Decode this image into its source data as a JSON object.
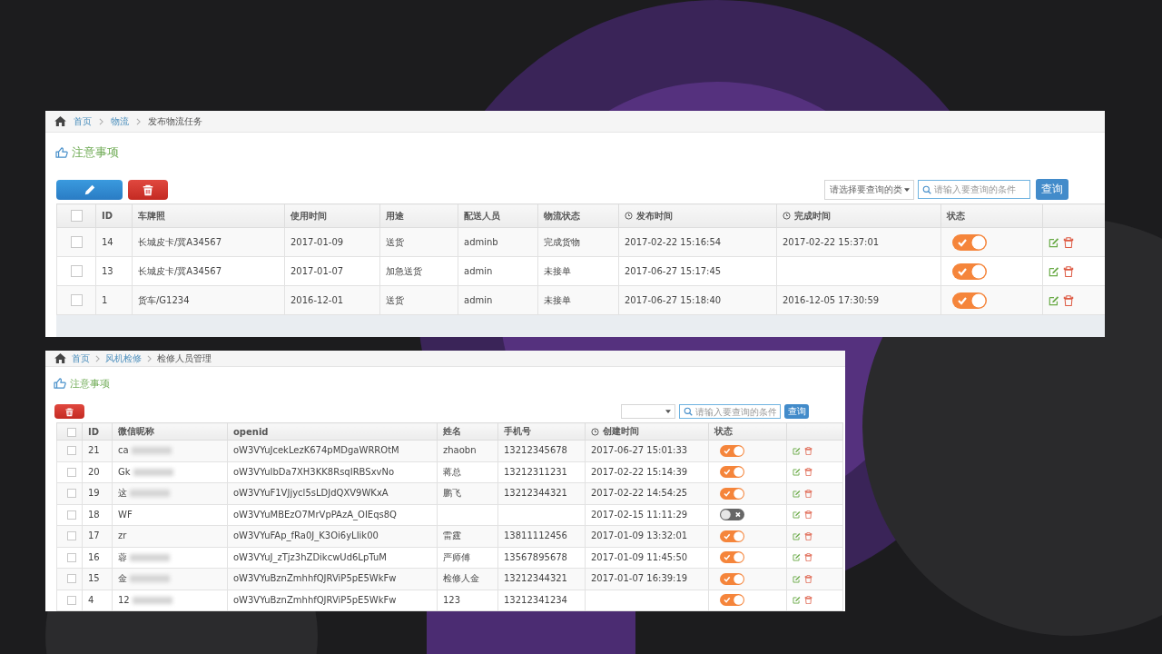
{
  "panels": [
    {
      "breadcrumb": [
        "首页",
        "物流",
        "发布物流任务"
      ],
      "notice": "注意事项",
      "toolbar": [
        {
          "kind": "edit"
        },
        {
          "kind": "delete"
        }
      ],
      "search": {
        "select_placeholder": "请选择要查询的类",
        "input_placeholder": "请输入要查询的条件",
        "button": "查询"
      },
      "header_checked": false,
      "columns": [
        {
          "label": "ID",
          "kind": "text"
        },
        {
          "label": "车牌照",
          "kind": "text"
        },
        {
          "label": "使用时间",
          "kind": "text"
        },
        {
          "label": "用途",
          "kind": "text"
        },
        {
          "label": "配送人员",
          "kind": "text"
        },
        {
          "label": "物流状态",
          "kind": "text"
        },
        {
          "label": "发布时间",
          "kind": "time"
        },
        {
          "label": "完成时间",
          "kind": "time"
        }
      ],
      "status_label": "状态",
      "rows": [
        {
          "checked": false,
          "on": true,
          "cells": [
            "14",
            "长城皮卡/冀A34567",
            "2017-01-09",
            "送货",
            "adminb",
            "完成货物",
            "2017-02-22 15:16:54",
            "2017-02-22 15:37:01"
          ]
        },
        {
          "checked": false,
          "on": true,
          "cells": [
            "13",
            "长城皮卡/冀A34567",
            "2017-01-07",
            "加急送货",
            "admin",
            "未接单",
            "2017-06-27 15:17:45",
            null
          ]
        },
        {
          "checked": false,
          "on": true,
          "cells": [
            "1",
            "货车/G1234",
            "2016-12-01",
            "送货",
            "admin",
            "未接单",
            "2017-06-27 15:18:40",
            "2016-12-05 17:30:59"
          ]
        }
      ]
    },
    {
      "breadcrumb": [
        "首页",
        "风机检修",
        "检修人员管理"
      ],
      "notice": "注意事项",
      "toolbar": [
        {
          "kind": "delete"
        }
      ],
      "search": {
        "input_placeholder": "请输入要查询的条件",
        "button": "查询"
      },
      "header_checked": false,
      "columns": [
        {
          "label": "ID",
          "kind": "text"
        },
        {
          "label": "微信昵称",
          "kind": "nickname"
        },
        {
          "label": "openid",
          "kind": "text"
        },
        {
          "label": "姓名",
          "kind": "text"
        },
        {
          "label": "手机号",
          "kind": "text"
        },
        {
          "label": "创建时间",
          "kind": "time"
        }
      ],
      "status_label": "状态",
      "rows": [
        {
          "checked": false,
          "on": true,
          "blurred": true,
          "cells": [
            "21",
            "ca",
            "oW3VYuJcekLezK674pMDgaWRROtM",
            "zhaobn",
            "13212345678",
            "2017-06-27 15:01:33"
          ]
        },
        {
          "checked": false,
          "on": true,
          "blurred": true,
          "cells": [
            "20",
            "Gk",
            "oW3VYuIbDa7XH3KK8RsqIRBSxvNo",
            "蒋总",
            "13212311231",
            "2017-02-22 15:14:39"
          ]
        },
        {
          "checked": false,
          "on": true,
          "blurred": true,
          "cells": [
            "19",
            "这",
            "oW3VYuF1VJjycl5sLDJdQXV9WKxA",
            "鹏飞",
            "13212344321",
            "2017-02-22 14:54:25"
          ]
        },
        {
          "checked": false,
          "on": false,
          "blurred": false,
          "cells": [
            "18",
            "WF",
            "oW3VYuMBEzO7MrVpPAzA_OIEqs8Q",
            null,
            null,
            "2017-02-15 11:11:29"
          ]
        },
        {
          "checked": false,
          "on": true,
          "blurred": false,
          "cells": [
            "17",
            "zr",
            "oW3VYuFAp_fRa0J_K3Oi6yLIik00",
            "雷霆",
            "13811112456",
            "2017-01-09 13:32:01"
          ]
        },
        {
          "checked": false,
          "on": true,
          "blurred": true,
          "cells": [
            "16",
            "蓉",
            "oW3VYuJ_zTjz3hZDikcwUd6LpTuM",
            "严师傅",
            "13567895678",
            "2017-01-09 11:45:50"
          ]
        },
        {
          "checked": false,
          "on": true,
          "blurred": true,
          "cells": [
            "15",
            "金",
            "oW3VYuBznZmhhfQJRViP5pE5WkFw",
            "检修人金",
            "13212344321",
            "2017-01-07 16:39:19"
          ]
        },
        {
          "checked": false,
          "on": true,
          "blurred": true,
          "cells": [
            "4",
            "12",
            "oW3VYuBznZmhhfQJRViP5pE5WkFw",
            "123",
            "13212341234",
            null
          ]
        }
      ]
    }
  ]
}
